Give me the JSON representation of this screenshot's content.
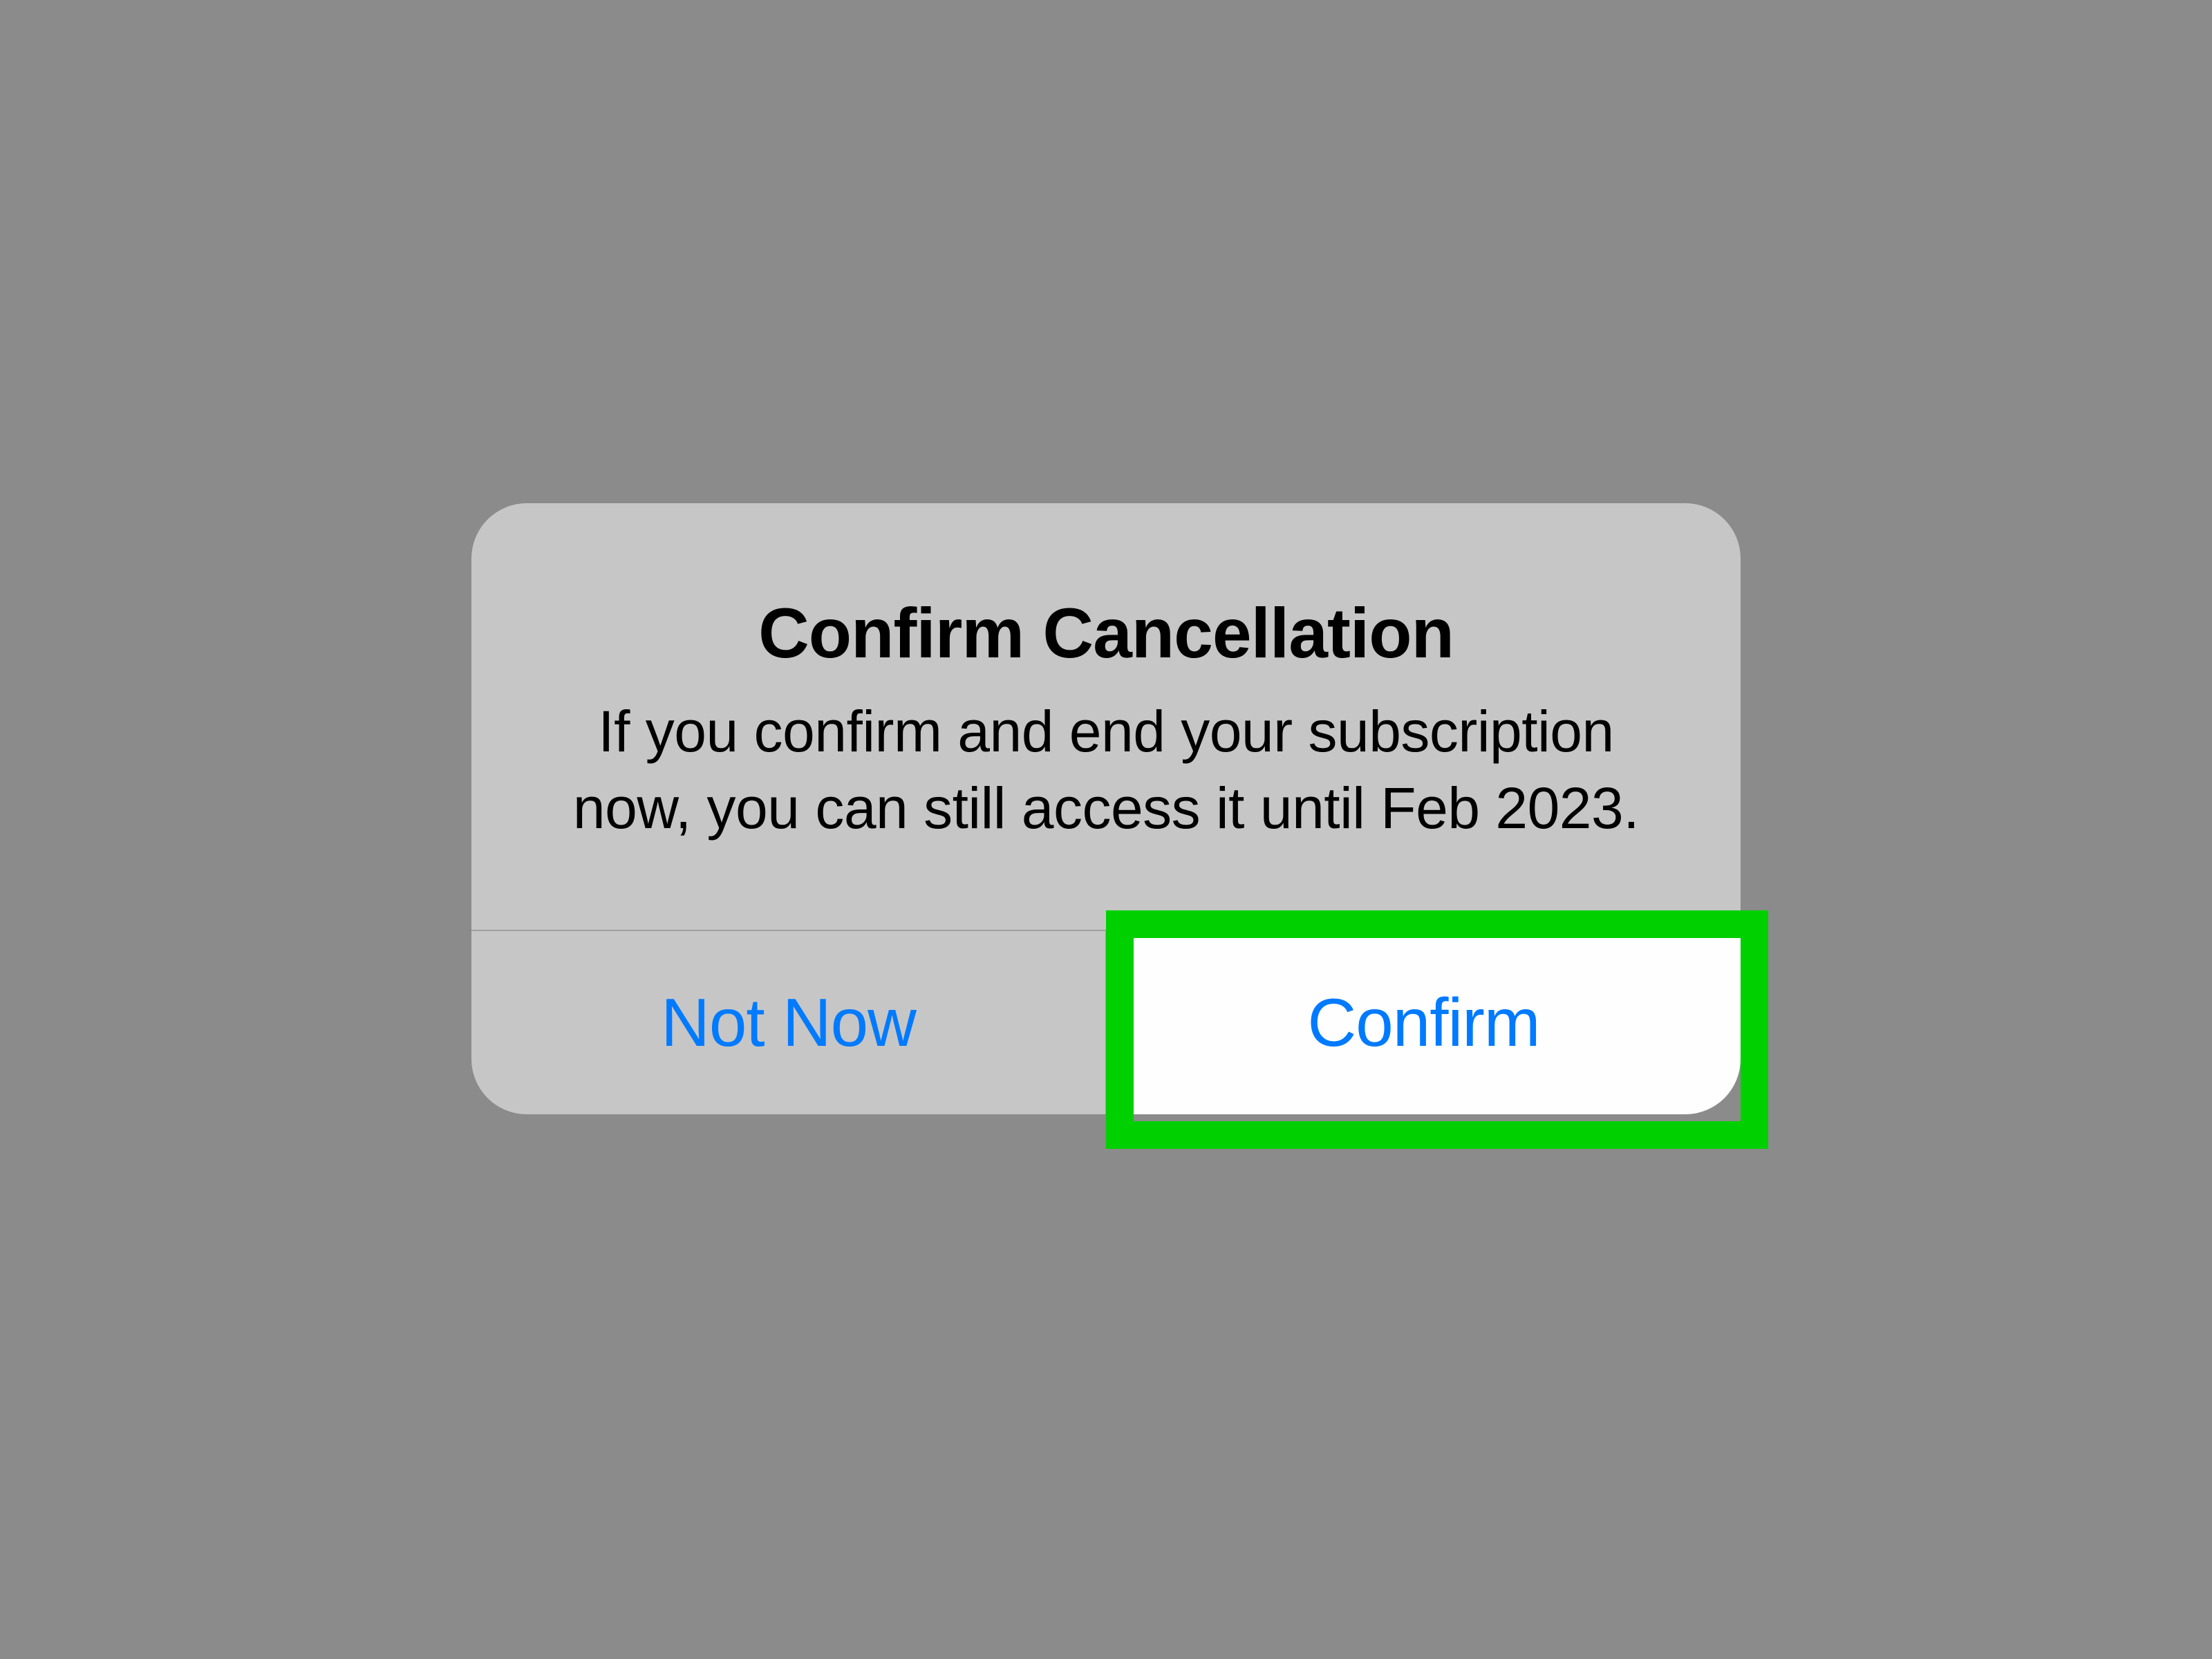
{
  "dialog": {
    "title": "Confirm Cancellation",
    "message": "If you confirm and end your subscription now, you can still access it until Feb 2023.",
    "cancel_label": "Not Now",
    "confirm_label": "Confirm"
  },
  "highlight": {
    "color": "#00d000"
  }
}
